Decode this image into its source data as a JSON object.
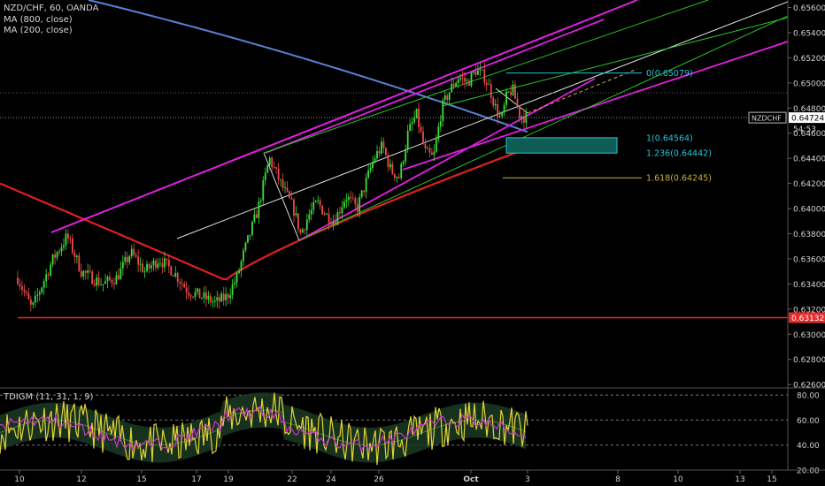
{
  "header": {
    "symbol_line": "NZD/CHF, 60, OANDA",
    "ma1": "MA (800, close)",
    "ma2": "MA (200, close)"
  },
  "indicator": {
    "title": "TDIGM (11, 31, 1, 9)"
  },
  "chart_data": {
    "type": "candlestick",
    "symbol": "NZD/CHF",
    "timeframe": "60",
    "source": "OANDA",
    "x_ticks": [
      "10",
      "12",
      "15",
      "17",
      "19",
      "22",
      "24",
      "26",
      "Oct",
      "3",
      "8",
      "10",
      "13",
      "15"
    ],
    "y_ticks": [
      "0.65600",
      "0.65400",
      "0.65200",
      "0.65000",
      "0.64800",
      "0.64600",
      "0.64400",
      "0.64200",
      "0.64000",
      "0.63800",
      "0.63600",
      "0.63400",
      "0.63200",
      "0.63000",
      "0.62800",
      "0.62600"
    ],
    "ylim": [
      0.6258,
      0.6566
    ],
    "current_price_label": "NZDCHF",
    "current_price": "0.64724",
    "countdown": "54:53",
    "support_level": "0.63132",
    "fib_labels": [
      {
        "text": "0(0.65079)",
        "value": 0.65079,
        "color": "#26c6da"
      },
      {
        "text": "1(0.64564)",
        "value": 0.64564,
        "color": "#26c6da"
      },
      {
        "text": "1.236(0.64442)",
        "value": 0.64442,
        "color": "#26c6da"
      },
      {
        "text": "1.618(0.64245)",
        "value": 0.64245,
        "color": "#c9b037"
      }
    ],
    "approx_close_path": [
      [
        0,
        0.6345
      ],
      [
        10,
        0.632
      ],
      [
        25,
        0.636
      ],
      [
        35,
        0.6378
      ],
      [
        45,
        0.635
      ],
      [
        60,
        0.634
      ],
      [
        70,
        0.6345
      ],
      [
        80,
        0.6365
      ],
      [
        90,
        0.635
      ],
      [
        100,
        0.636
      ],
      [
        110,
        0.635
      ],
      [
        120,
        0.6335
      ],
      [
        130,
        0.633
      ],
      [
        140,
        0.6325
      ],
      [
        148,
        0.633
      ],
      [
        155,
        0.6345
      ],
      [
        160,
        0.6365
      ],
      [
        170,
        0.64
      ],
      [
        178,
        0.644
      ],
      [
        186,
        0.642
      ],
      [
        195,
        0.64
      ],
      [
        200,
        0.638
      ],
      [
        206,
        0.6395
      ],
      [
        212,
        0.6405
      ],
      [
        218,
        0.6395
      ],
      [
        224,
        0.639
      ],
      [
        232,
        0.641
      ],
      [
        240,
        0.64
      ],
      [
        246,
        0.642
      ],
      [
        252,
        0.644
      ],
      [
        258,
        0.645
      ],
      [
        264,
        0.643
      ],
      [
        270,
        0.6425
      ],
      [
        276,
        0.646
      ],
      [
        282,
        0.6475
      ],
      [
        288,
        0.6445
      ],
      [
        294,
        0.644
      ],
      [
        300,
        0.648
      ],
      [
        306,
        0.6495
      ],
      [
        312,
        0.6505
      ],
      [
        318,
        0.65
      ],
      [
        324,
        0.651
      ],
      [
        330,
        0.6505
      ],
      [
        334,
        0.6495
      ],
      [
        338,
        0.648
      ],
      [
        342,
        0.647
      ],
      [
        346,
        0.649
      ],
      [
        350,
        0.6495
      ],
      [
        355,
        0.6475
      ],
      [
        360,
        0.6472
      ]
    ],
    "ma800_color": "#5b7fd4",
    "ma200_color": "#e02020",
    "indicator_levels": [
      80,
      60,
      40,
      20
    ],
    "indicator_ylim": [
      20,
      85
    ]
  }
}
